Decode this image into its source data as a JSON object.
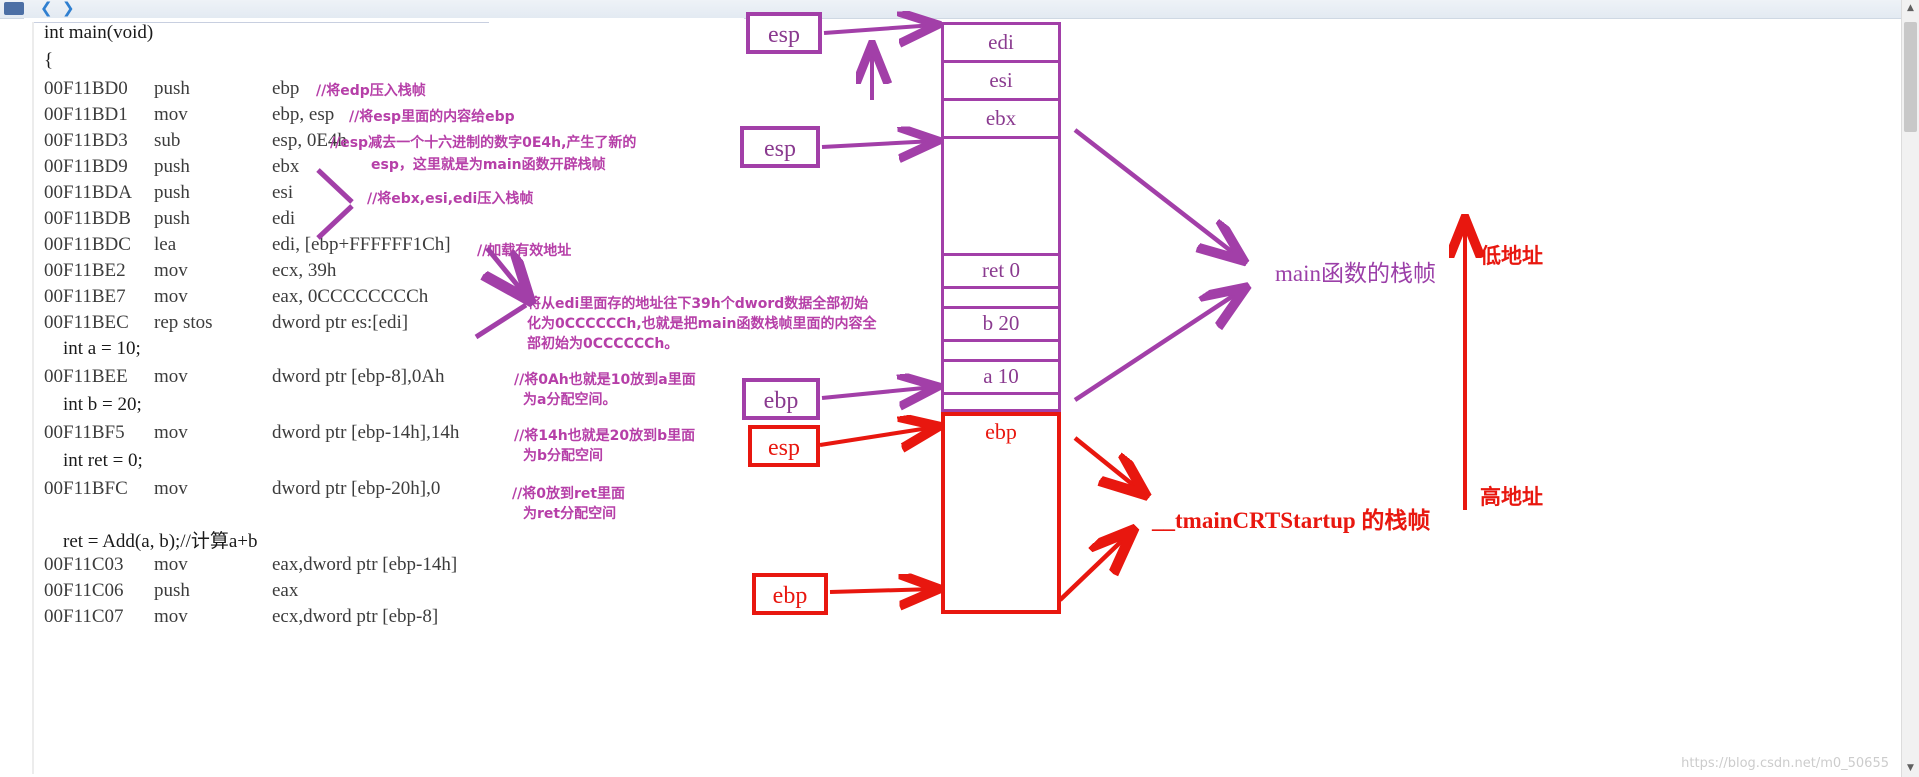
{
  "window": {
    "scroll_up_icon": "▲",
    "scroll_down_icon": "▼"
  },
  "code": {
    "lines": [
      {
        "addr": "",
        "mnem": "",
        "src": "int main(void)"
      },
      {
        "addr": "",
        "mnem": "",
        "src": "{"
      },
      {
        "addr": "00F11BD0",
        "mnem": "push",
        "ops": "ebp"
      },
      {
        "addr": "00F11BD1",
        "mnem": "mov",
        "ops": "ebp, esp"
      },
      {
        "addr": "00F11BD3",
        "mnem": "sub",
        "ops": "esp, 0E4h"
      },
      {
        "addr": "00F11BD9",
        "mnem": "push",
        "ops": "ebx"
      },
      {
        "addr": "00F11BDA",
        "mnem": "push",
        "ops": "esi"
      },
      {
        "addr": "00F11BDB",
        "mnem": "push",
        "ops": "edi"
      },
      {
        "addr": "00F11BDC",
        "mnem": "lea",
        "ops": "edi, [ebp+FFFFFF1Ch]"
      },
      {
        "addr": "00F11BE2",
        "mnem": "mov",
        "ops": "ecx, 39h"
      },
      {
        "addr": "00F11BE7",
        "mnem": "mov",
        "ops": "eax, 0CCCCCCCCh"
      },
      {
        "addr": "00F11BEC",
        "mnem": "rep stos",
        "ops": "dword ptr es:[edi]"
      },
      {
        "addr": "",
        "mnem": "",
        "src": "    int a = 10;"
      },
      {
        "addr": "00F11BEE",
        "mnem": "mov",
        "ops": "dword ptr [ebp-8],0Ah"
      },
      {
        "addr": "",
        "mnem": "",
        "src": "    int b = 20;"
      },
      {
        "addr": "00F11BF5",
        "mnem": "mov",
        "ops": "dword ptr [ebp-14h],14h"
      },
      {
        "addr": "",
        "mnem": "",
        "src": "    int ret = 0;"
      },
      {
        "addr": "00F11BFC",
        "mnem": "mov",
        "ops": "dword ptr [ebp-20h],0"
      },
      {
        "addr": "",
        "mnem": "",
        "src": ""
      },
      {
        "addr": "",
        "mnem": "",
        "src": "    ret = Add(a, b);//计算a+b"
      },
      {
        "addr": "00F11C03",
        "mnem": "mov",
        "ops": "eax,dword ptr [ebp-14h]"
      },
      {
        "addr": "00F11C06",
        "mnem": "push",
        "ops": "eax"
      },
      {
        "addr": "00F11C07",
        "mnem": "mov",
        "ops": "ecx,dword ptr [ebp-8]"
      }
    ],
    "comments": [
      {
        "text": "//将edp压入栈帧"
      },
      {
        "text": "//将esp里面的内容给ebp"
      },
      {
        "text": "//esp减去一个十六进制的数字0E4h,产生了新的"
      },
      {
        "text": "esp，这里就是为main函数开辟栈帧"
      },
      {
        "text": "//将ebx,esi,edi压入栈帧"
      },
      {
        "text": "//加载有效地址"
      },
      {
        "text": "将从edi里面存的地址往下39h个dword数据全部初始"
      },
      {
        "text": "化为0CCCCCCh,也就是把main函数栈帧里面的内容全"
      },
      {
        "text": "部初始为0CCCCCCh。"
      },
      {
        "text": "//将0Ah也就是10放到a里面"
      },
      {
        "text": "为a分配空间。"
      },
      {
        "text": "//将14h也就是20放到b里面"
      },
      {
        "text": "为b分配空间"
      },
      {
        "text": "//将0放到ret里面"
      },
      {
        "text": "为ret分配空间"
      }
    ]
  },
  "registers": [
    {
      "label": "esp",
      "color": "purple"
    },
    {
      "label": "esp",
      "color": "purple"
    },
    {
      "label": "ebp",
      "color": "purple"
    },
    {
      "label": "esp",
      "color": "red"
    },
    {
      "label": "ebp",
      "color": "red"
    }
  ],
  "stack": {
    "cells": [
      {
        "label": "edi",
        "color": "purple"
      },
      {
        "label": "esi",
        "color": "purple"
      },
      {
        "label": "ebx",
        "color": "purple"
      },
      {
        "label": "",
        "color": "purple"
      },
      {
        "label": "ret 0",
        "color": "purple"
      },
      {
        "label": "",
        "color": "purple"
      },
      {
        "label": "b  20",
        "color": "purple"
      },
      {
        "label": "",
        "color": "purple"
      },
      {
        "label": "a  10",
        "color": "purple"
      },
      {
        "label": "",
        "color": "purple"
      },
      {
        "label": "ebp",
        "color": "red"
      },
      {
        "label": "",
        "color": "red"
      }
    ]
  },
  "annotations": {
    "main_frame": "main函数的栈帧",
    "crt_frame": "__tmainCRTStartup 的栈帧",
    "low_address": "低地址",
    "high_address": "高地址"
  },
  "watermark": "https://blog.csdn.net/m0_50655",
  "colors": {
    "purple": "#a23fa8",
    "purple_text": "#8a3a8f",
    "comment_purple": "#b63fa8",
    "red": "#e8170f",
    "code_text": "#3c3c3c"
  }
}
